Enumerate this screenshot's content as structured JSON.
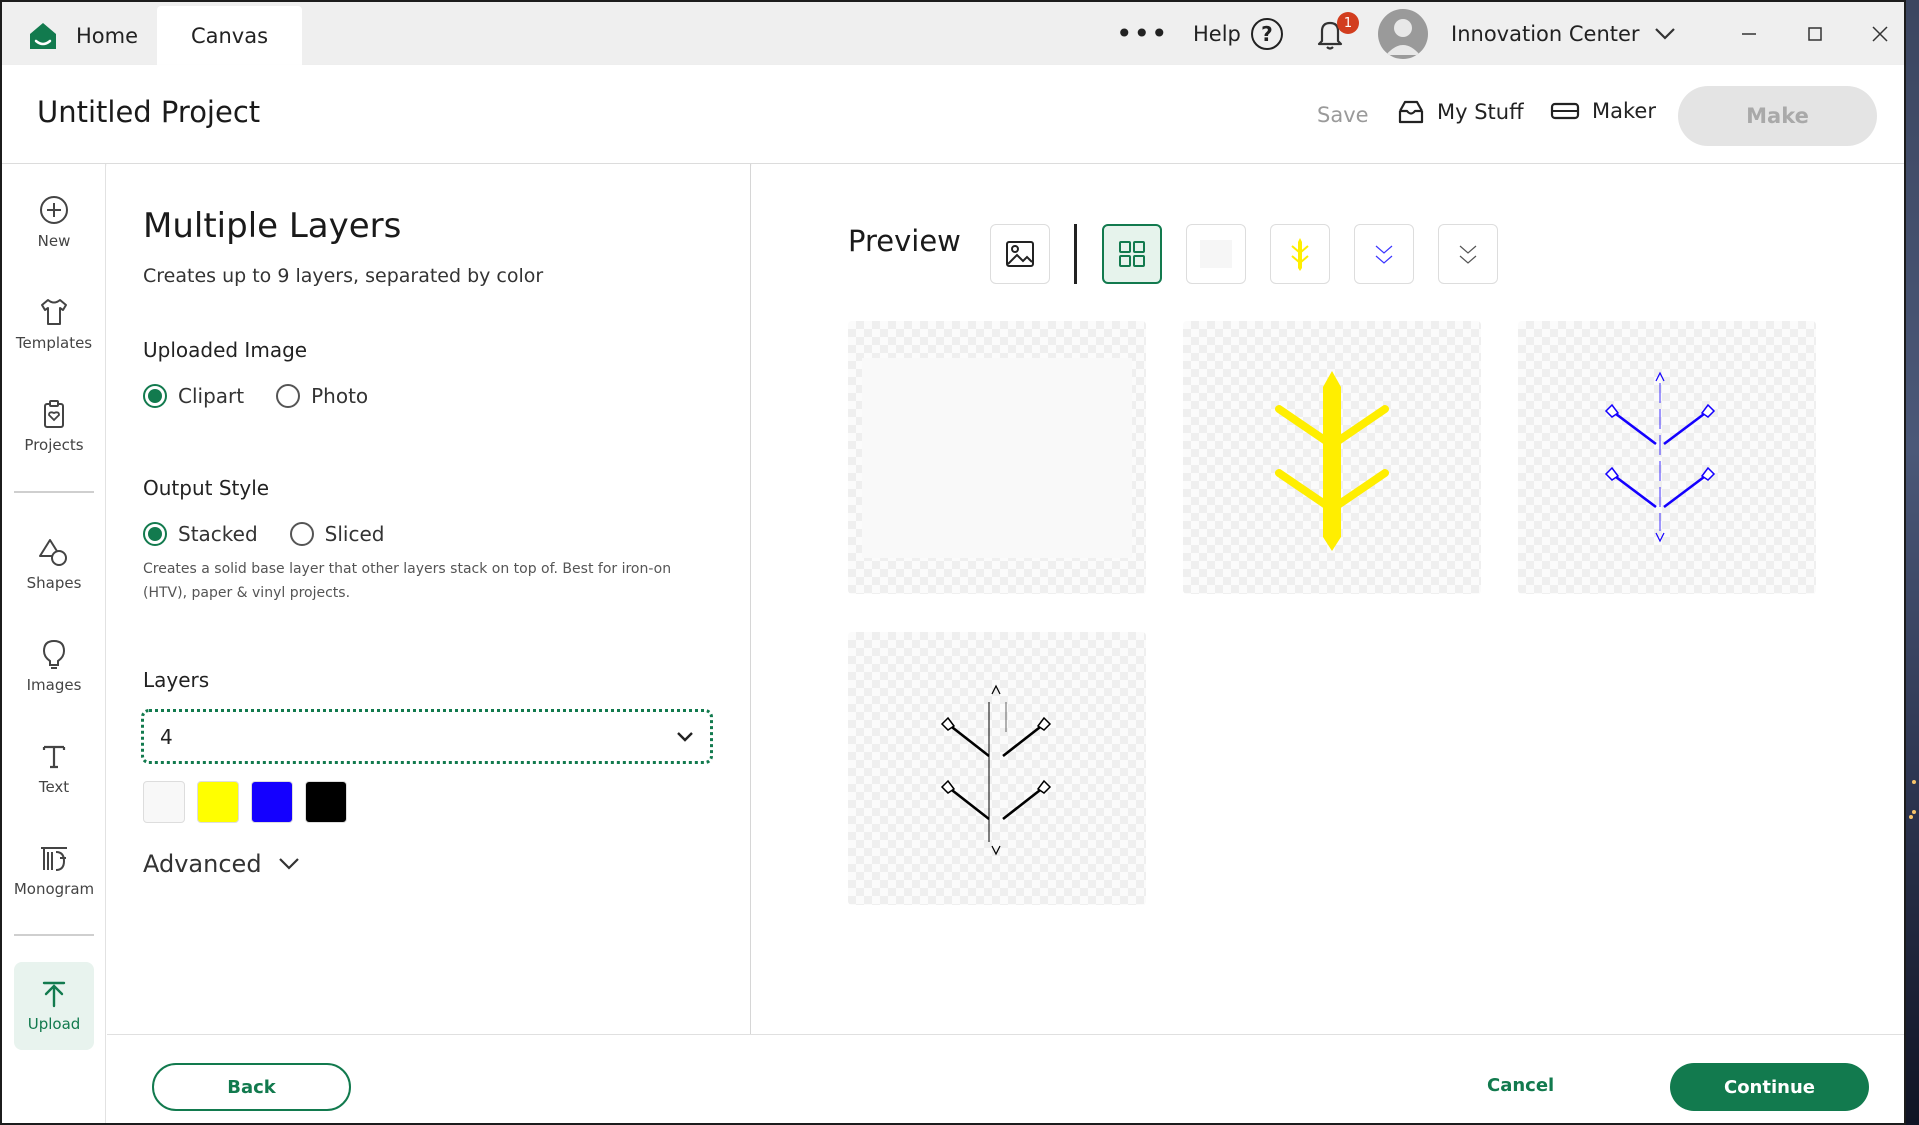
{
  "tabs": {
    "home": "Home",
    "canvas": "Canvas"
  },
  "titlebar": {
    "more": "•••",
    "help_label": "Help",
    "help_glyph": "?",
    "notification_count": "1",
    "account_name": "Innovation Center"
  },
  "header": {
    "project_title": "Untitled Project",
    "save": "Save",
    "my_stuff": "My Stuff",
    "maker": "Maker",
    "make": "Make"
  },
  "rail": {
    "new": "New",
    "templates": "Templates",
    "projects": "Projects",
    "shapes": "Shapes",
    "images": "Images",
    "text": "Text",
    "monogram": "Monogram",
    "upload": "Upload"
  },
  "panel": {
    "title": "Multiple Layers",
    "subtitle": "Creates up to 9 layers, separated by color",
    "uploaded_image_label": "Uploaded Image",
    "clipart": "Clipart",
    "photo": "Photo",
    "output_style_label": "Output Style",
    "stacked": "Stacked",
    "sliced": "Sliced",
    "output_help": "Creates a solid base layer that other layers stack on top of. Best for iron-on (HTV), paper & vinyl projects.",
    "layers_label": "Layers",
    "layers_value": "4",
    "swatch_colors": [
      "#f8f8f8",
      "#ffff00",
      "#1400ff",
      "#000000"
    ],
    "advanced": "Advanced"
  },
  "preview": {
    "title": "Preview"
  },
  "footer": {
    "back": "Back",
    "cancel": "Cancel",
    "continue": "Continue"
  },
  "colors": {
    "accent": "#127a4e",
    "notification": "#d23d1e"
  }
}
